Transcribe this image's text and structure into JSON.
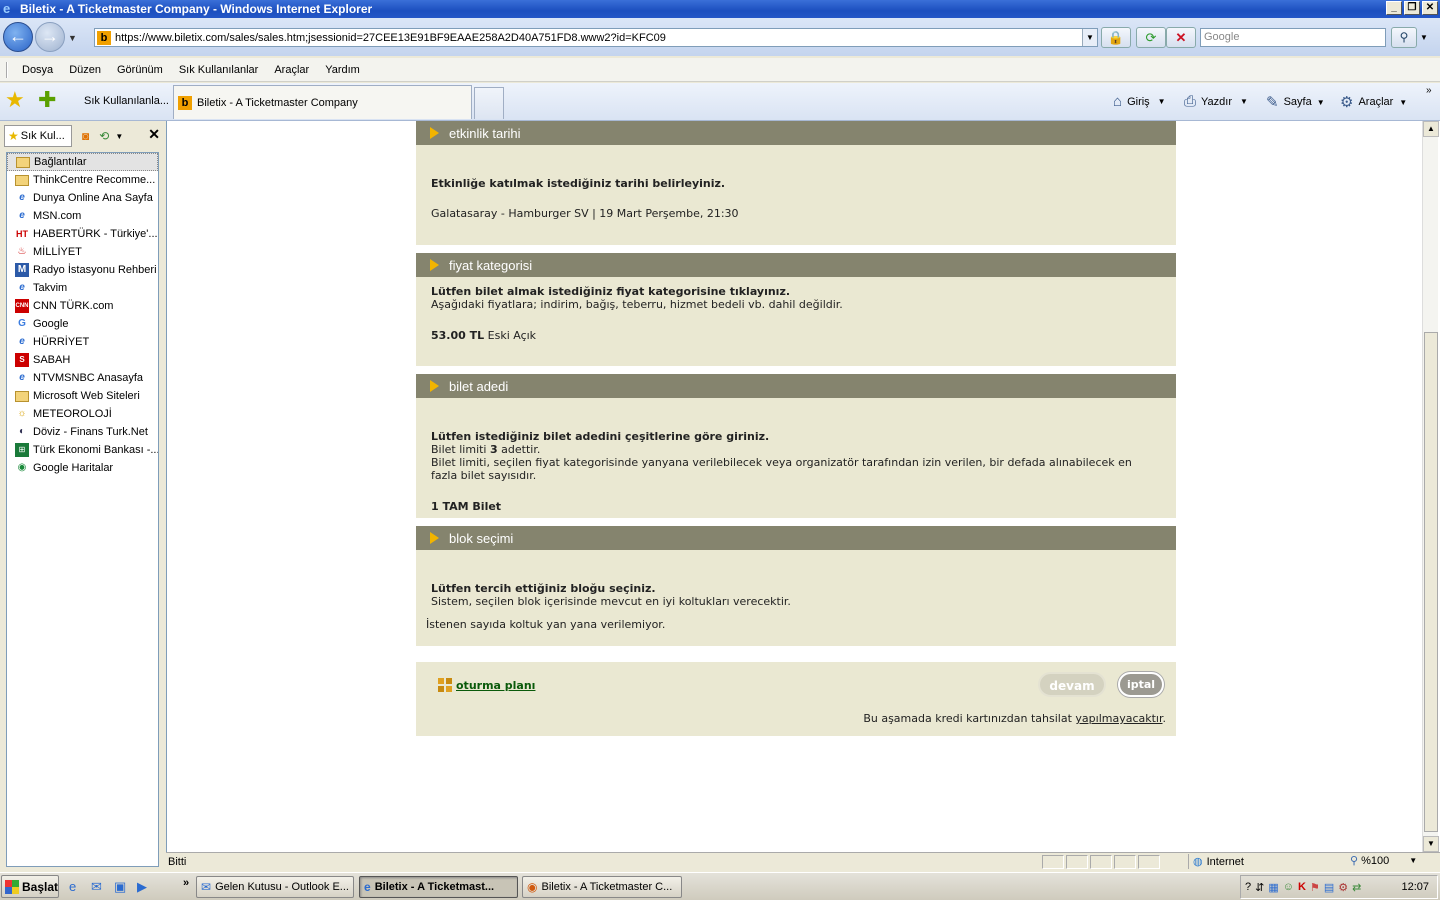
{
  "window": {
    "title": "Biletix - A Ticketmaster Company - Windows Internet Explorer",
    "controls": [
      "minimize",
      "restore",
      "close"
    ]
  },
  "address_bar": {
    "url": "https://www.biletix.com/sales/sales.htm;jsessionid=27CEE13E91BF9EAAE258A2D40A751FD8.www2?id=KFC09",
    "search_placeholder": "Google"
  },
  "menu": [
    "Dosya",
    "Düzen",
    "Görünüm",
    "Sık Kullanılanlar",
    "Araçlar",
    "Yardım"
  ],
  "favbar": {
    "favorites_label": "Sık Kullanılanla...",
    "active_tab": "Biletix - A Ticketmaster Company",
    "commands": {
      "home": "Giriş",
      "print": "Yazdır",
      "page": "Sayfa",
      "tools": "Araçlar"
    }
  },
  "favorites_panel": {
    "tab_label": "Sık Kul...",
    "items": [
      {
        "label": "Bağlantılar",
        "icon": "folder-icon"
      },
      {
        "label": "ThinkCentre Recomme...",
        "icon": "folder-icon"
      },
      {
        "label": "Dunya Online Ana Sayfa",
        "icon": "ie-page-icon"
      },
      {
        "label": "MSN.com",
        "icon": "ie-page-icon"
      },
      {
        "label": "HABERTÜRK - Türkiye'...",
        "icon": "haberturk-icon"
      },
      {
        "label": "MİLLİYET",
        "icon": "milliyet-icon"
      },
      {
        "label": "Radyo İstasyonu Rehberi",
        "icon": "radio-icon"
      },
      {
        "label": "Takvim",
        "icon": "ie-page-icon"
      },
      {
        "label": "CNN TÜRK.com",
        "icon": "cnn-icon"
      },
      {
        "label": "Google",
        "icon": "google-icon"
      },
      {
        "label": "HÜRRİYET",
        "icon": "ie-page-icon"
      },
      {
        "label": "SABAH",
        "icon": "sabah-icon"
      },
      {
        "label": "NTVMSNBC Anasayfa",
        "icon": "ie-page-icon"
      },
      {
        "label": "Microsoft Web Siteleri",
        "icon": "folder-icon"
      },
      {
        "label": "METEOROLOJİ",
        "icon": "meteoroloji-icon"
      },
      {
        "label": "Döviz - Finans Turk.Net",
        "icon": "doviz-icon"
      },
      {
        "label": "Türk Ekonomi Bankası -...",
        "icon": "teb-icon"
      },
      {
        "label": "Google Haritalar",
        "icon": "maps-icon"
      }
    ]
  },
  "page": {
    "sections": {
      "date": {
        "title": "etkinlik tarihi",
        "instruction": "Etkinliğe katılmak istediğiniz tarihi belirleyiniz.",
        "event": "Galatasaray - Hamburger SV | 19 Mart Perşembe, 21:30"
      },
      "price": {
        "title": "fiyat kategorisi",
        "instruction": "Lütfen bilet almak istediğiniz fiyat kategorisine tıklayınız.",
        "note": "Aşağıdaki fiyatlara; indirim, bağış, teberru, hizmet bedeli vb. dahil değildir.",
        "amount": "53.00 TL",
        "category": "Eski Açık"
      },
      "quantity": {
        "title": "bilet adedi",
        "instruction": "Lütfen istediğiniz bilet adedini çeşitlerine göre giriniz.",
        "limit_prefix": "Bilet limiti",
        "limit_value": "3",
        "limit_suffix": "adettir.",
        "limit_explanation": "Bilet limiti, seçilen fiyat kategorisinde yanyana verilebilecek veya organizatör tarafından izin verilen, bir defada alınabilecek en fazla bilet sayısıdır.",
        "selection": "1 TAM Bilet"
      },
      "block": {
        "title": "blok seçimi",
        "instruction": "Lütfen tercih ettiğiniz bloğu seçiniz.",
        "note": "Sistem, seçilen blok içerisinde mevcut en iyi koltukları verecektir.",
        "warning": "İstenen sayıda koltuk yan yana verilemiyor."
      }
    },
    "actions": {
      "seat_plan": "oturma planı",
      "continue": "devam",
      "cancel": "iptal",
      "notice_prefix": "Bu aşamada kredi kartınızdan tahsilat",
      "notice_link": "yapılmayacaktır",
      "notice_suffix": "."
    }
  },
  "statusbar": {
    "text": "Bitti",
    "zone": "Internet",
    "zoom": "%100"
  },
  "taskbar": {
    "start": "Başlat",
    "tasks": [
      {
        "label": "Gelen Kutusu - Outlook E...",
        "active": false
      },
      {
        "label": "Biletix - A Ticketmast...",
        "active": true
      },
      {
        "label": "Biletix - A Ticketmaster C...",
        "active": false
      }
    ],
    "clock": "12:07"
  }
}
